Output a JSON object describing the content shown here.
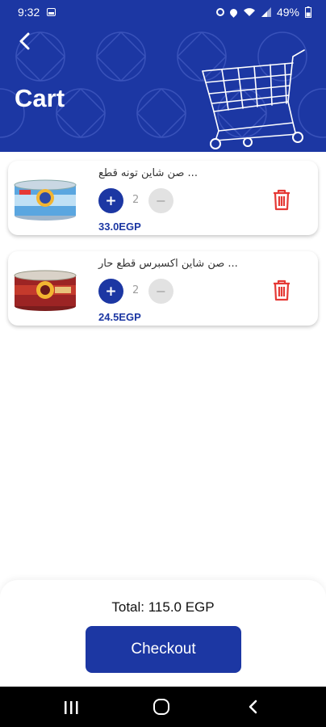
{
  "status_bar": {
    "time": "9:32",
    "battery": "49%"
  },
  "header": {
    "title": "Cart"
  },
  "items": [
    {
      "name": "صن شاين تونه قطع ...",
      "quantity": "2",
      "price": "33.0EGP",
      "plus_label": "+",
      "minus_label": "−"
    },
    {
      "name": "صن شاين اكسبرس قطع حار ...",
      "quantity": "2",
      "price": "24.5EGP",
      "plus_label": "+",
      "minus_label": "−"
    }
  ],
  "footer": {
    "total": "Total: 115.0 EGP",
    "checkout_label": "Checkout"
  },
  "colors": {
    "primary": "#1c37a3",
    "danger": "#e53935",
    "disabled": "#e2e2e2"
  },
  "icons": [
    "back-arrow-icon",
    "shopping-cart-icon",
    "trash-icon",
    "plus-icon",
    "minus-icon"
  ]
}
